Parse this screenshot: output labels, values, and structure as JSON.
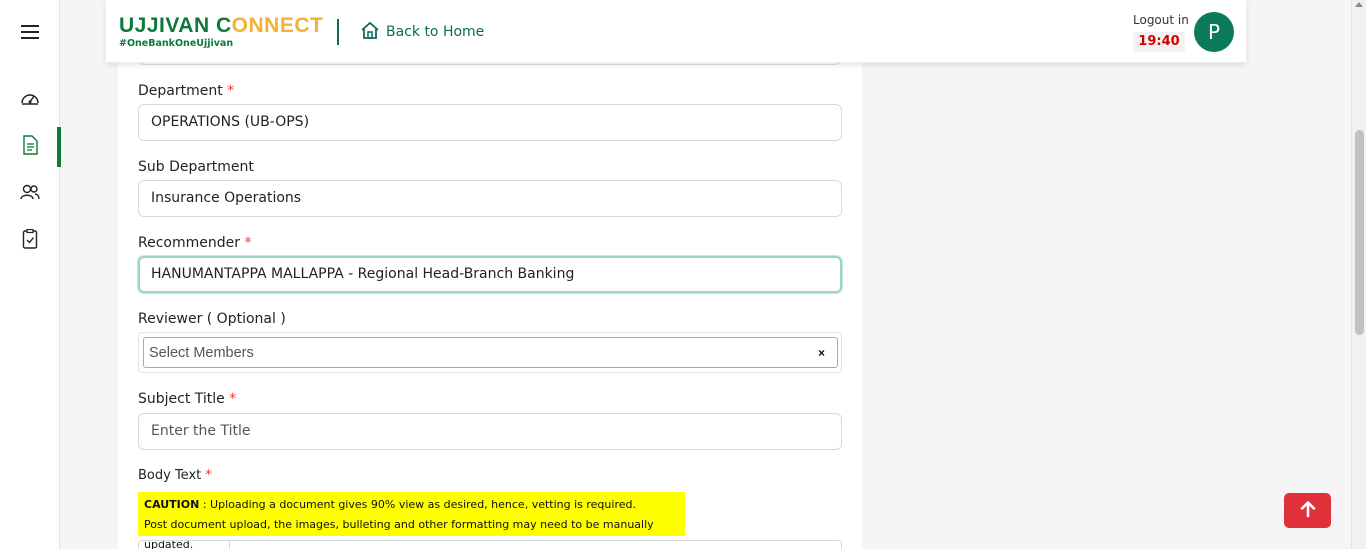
{
  "header": {
    "logo_part1": "UJJIVAN C",
    "logo_part2": "NNECT",
    "logo_tagline": "#OneBankOneUjjivan",
    "back_home": "Back to Home",
    "logout_label": "Logout in",
    "timer": "19:40",
    "avatar_letter": "P"
  },
  "sidebar": {
    "items": [
      {
        "icon": "menu-icon"
      },
      {
        "icon": "dashboard-gauge-icon"
      },
      {
        "icon": "document-icon",
        "active": true
      },
      {
        "icon": "users-icon"
      },
      {
        "icon": "clipboard-check-icon"
      }
    ]
  },
  "form": {
    "department": {
      "label": "Department",
      "required": "*",
      "value": "OPERATIONS (UB-OPS)"
    },
    "sub_department": {
      "label": "Sub Department",
      "value": "Insurance Operations"
    },
    "recommender": {
      "label": "Recommender",
      "required": "*",
      "value": "HANUMANTAPPA MALLAPPA - Regional Head-Branch Banking"
    },
    "reviewer": {
      "label": "Reviewer ( Optional )",
      "placeholder": "Select Members",
      "clear": "×"
    },
    "subject": {
      "label": "Subject Title",
      "required": "*",
      "placeholder": "Enter the Title"
    },
    "body": {
      "label": "Body Text",
      "required": "*"
    },
    "caution": {
      "heading": "CAUTION",
      "line1": " : Uploading a document gives 90% view as desired, hence, vetting is required.",
      "line2": "Post document upload, the images, bulleting and other formatting may need to be manually updated."
    }
  },
  "colors": {
    "brand_green": "#0d7a38",
    "brand_yellow": "#f2b233",
    "teal": "#0d6a5e",
    "timer_red": "#d60000",
    "caution_yellow": "#ffff00",
    "scroll_top_red": "#e0303a"
  }
}
